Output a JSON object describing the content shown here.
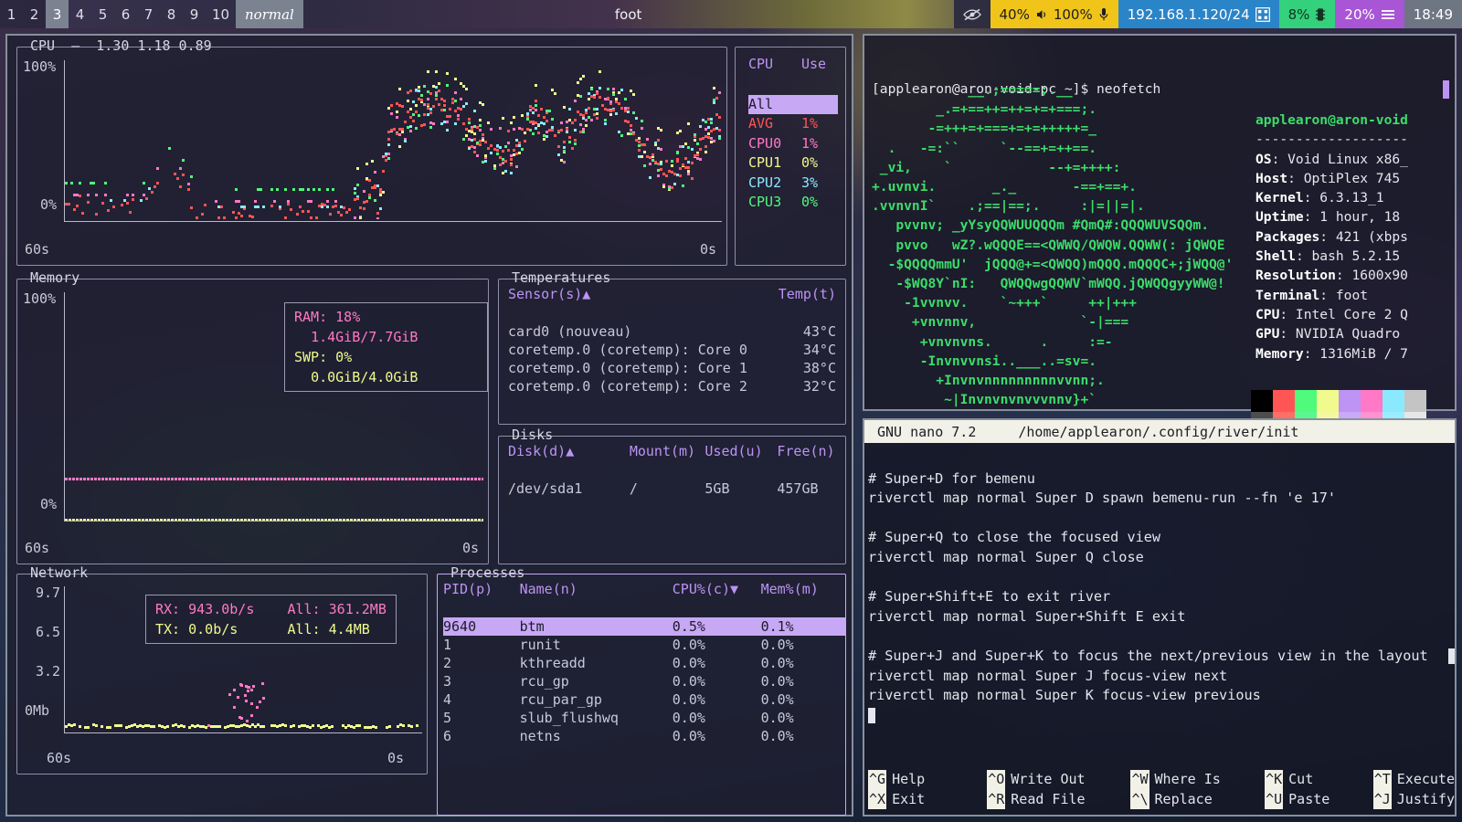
{
  "topbar": {
    "tags": [
      "1",
      "2",
      "3",
      "4",
      "5",
      "6",
      "7",
      "8",
      "9",
      "10"
    ],
    "active_tag": "3",
    "occupied_tags": [
      "1",
      "2",
      "3"
    ],
    "mode": "normal",
    "window_title": "foot",
    "modules": {
      "idle_icon": "eye-slash-icon",
      "volume_speaker": "40%",
      "volume_speaker_icon": "speaker-icon",
      "volume_mic": "100%",
      "volume_mic_icon": "microphone-icon",
      "network": "192.168.1.120/24",
      "network_icon": "network-qr-icon",
      "cpu": "8%",
      "cpu_icon": "chip-icon",
      "memory": "20%",
      "memory_icon": "memory-bars-icon",
      "clock": "18:49"
    },
    "colors": {
      "active_tag_bg": "#7b8391",
      "volume_bg": "#f0c419",
      "network_bg": "#2a84c8",
      "cpu_bg": "#34d17c",
      "memory_bg": "#a855d6",
      "clock_bg": "#6f7683"
    }
  },
  "btm": {
    "cpu_panel": {
      "title": "CPU",
      "load_avg": "1.30 1.18 0.89",
      "y_top": "100%",
      "y_bottom": "0%",
      "x_left": "60s",
      "x_right": "0s"
    },
    "cpu_table": {
      "headers": [
        "CPU",
        "Use"
      ],
      "rows": [
        {
          "name": "All",
          "use": "",
          "color": "#1c1c2b",
          "selected": true
        },
        {
          "name": "AVG",
          "use": "1%",
          "color": "#ff5555",
          "selected": false
        },
        {
          "name": "CPU0",
          "use": "1%",
          "color": "#ff79c6",
          "selected": false
        },
        {
          "name": "CPU1",
          "use": "0%",
          "color": "#f1fa8c",
          "selected": false
        },
        {
          "name": "CPU2",
          "use": "3%",
          "color": "#8be9fd",
          "selected": false
        },
        {
          "name": "CPU3",
          "use": "0%",
          "color": "#50fa7b",
          "selected": false
        }
      ]
    },
    "memory_panel": {
      "title": "Memory",
      "y_top": "100%",
      "y_bottom": "0%",
      "x_left": "60s",
      "x_right": "0s",
      "ram_label": "RAM:",
      "ram_pct": "18%",
      "ram_value": "1.4GiB/7.7GiB",
      "swp_label": "SWP:",
      "swp_pct": "0%",
      "swp_value": "0.0GiB/4.0GiB"
    },
    "temperatures": {
      "title": "Temperatures",
      "headers": [
        "Sensor(s)▲",
        "Temp(t)"
      ],
      "rows": [
        {
          "sensor": "card0 (nouveau)",
          "temp": "43°C"
        },
        {
          "sensor": "coretemp.0 (coretemp): Core 0",
          "temp": "34°C"
        },
        {
          "sensor": "coretemp.0 (coretemp): Core 1",
          "temp": "38°C"
        },
        {
          "sensor": "coretemp.0 (coretemp): Core 2",
          "temp": "32°C"
        }
      ]
    },
    "disks": {
      "title": "Disks",
      "headers": [
        "Disk(d)▲",
        "Mount(m)",
        "Used(u)",
        "Free(n)"
      ],
      "rows": [
        {
          "disk": "/dev/sda1",
          "mount": "/",
          "used": "5GB",
          "free": "457GB"
        }
      ]
    },
    "network_panel": {
      "title": "Network",
      "y_labels": [
        "9.7",
        "6.5",
        "3.2",
        "0Mb"
      ],
      "x_left": "60s",
      "x_right": "0s",
      "rx_label": "RX:",
      "rx_value": "943.0b/s",
      "rx_all_label": "All:",
      "rx_all_value": "361.2MB",
      "tx_label": "TX:",
      "tx_value": "0.0b/s",
      "tx_all_label": "All:",
      "tx_all_value": "4.4MB"
    },
    "processes": {
      "title": "Processes",
      "headers": [
        "PID(p)",
        "Name(n)",
        "CPU%(c)▼",
        "Mem%(m)"
      ],
      "rows": [
        {
          "pid": "9640",
          "name": "btm",
          "cpu": "0.5%",
          "mem": "0.1%",
          "selected": true
        },
        {
          "pid": "1",
          "name": "runit",
          "cpu": "0.0%",
          "mem": "0.0%",
          "selected": false
        },
        {
          "pid": "2",
          "name": "kthreadd",
          "cpu": "0.0%",
          "mem": "0.0%",
          "selected": false
        },
        {
          "pid": "3",
          "name": "rcu_gp",
          "cpu": "0.0%",
          "mem": "0.0%",
          "selected": false
        },
        {
          "pid": "4",
          "name": "rcu_par_gp",
          "cpu": "0.0%",
          "mem": "0.0%",
          "selected": false
        },
        {
          "pid": "5",
          "name": "slub_flushwq",
          "cpu": "0.0%",
          "mem": "0.0%",
          "selected": false
        },
        {
          "pid": "6",
          "name": "netns",
          "cpu": "0.0%",
          "mem": "0.0%",
          "selected": false
        }
      ]
    }
  },
  "chart_data": [
    {
      "type": "scatter",
      "title": "CPU",
      "xlabel": "",
      "ylabel": "",
      "ylim": [
        0,
        100
      ],
      "xlim": [
        60,
        0
      ],
      "ytick_labels": [
        "100%",
        "0%"
      ],
      "xtick_labels": [
        "60s",
        "0s"
      ],
      "legend": [
        "AVG",
        "CPU0",
        "CPU1",
        "CPU2",
        "CPU3"
      ],
      "series": [
        {
          "name": "AVG",
          "color": "#ff5555"
        },
        {
          "name": "CPU0",
          "color": "#ff79c6"
        },
        {
          "name": "CPU1",
          "color": "#f1fa8c"
        },
        {
          "name": "CPU2",
          "color": "#8be9fd"
        },
        {
          "name": "CPU3",
          "color": "#50fa7b"
        }
      ]
    },
    {
      "type": "line",
      "title": "Memory",
      "ylim": [
        0,
        100
      ],
      "xlim": [
        60,
        0
      ],
      "ytick_labels": [
        "100%",
        "0%"
      ],
      "xtick_labels": [
        "60s",
        "0s"
      ],
      "series": [
        {
          "name": "RAM",
          "color": "#ff79c6",
          "constant": 18
        },
        {
          "name": "SWP",
          "color": "#f1fa8c",
          "constant": 0
        }
      ]
    },
    {
      "type": "line",
      "title": "Network",
      "ylim": [
        0,
        9.7
      ],
      "xlim": [
        60,
        0
      ],
      "ytick_labels": [
        "9.7",
        "6.5",
        "3.2",
        "0Mb"
      ],
      "xtick_labels": [
        "60s",
        "0s"
      ],
      "series": [
        {
          "name": "RX",
          "color": "#ff79c6"
        },
        {
          "name": "TX",
          "color": "#f1fa8c"
        }
      ]
    }
  ],
  "terminal": {
    "prompt": "[applearon@aron-void-pc ~]$ neofetch",
    "ascii_art": "            __.;=====;.__\n        _.=+==++=++=+=+===;.\n       -=+++=+===+=+=+++++=_\n  .   -=:``     `--==+=++==.\n _vi,    `            --+=++++:\n+.uvnvi.       _._       -==+==+.\n.vvnvnI`    .;==|==;.     :|=||=|.\n   pvvnv; _yYsyQQWUUQQQm #QmQ#:QQQWUVSQQm.\n   pvvo   wZ?.wQQQE==<QWWQ/QWQW.QQWW(: jQWQE\n  -$QQQQmmU'  jQQQ@+=<QWQQ)mQQQ.mQQQC+;jWQQ@'\n   -$WQ8Y`nI:   QWQQwgQQWV`mWQQ.jQWQQgyyWW@!\n    -1vvnvv.    `~+++`     ++|+++\n     +vnvnnv,             `-|===\n      +vnvnvns.      .     :=-\n      -Invnvvnsi..___..=sv=.\n        +Invnvnnnnnnnnnvvnn;.\n         ~|Invnvnvnvvvnnv}+`",
    "info": [
      {
        "key": "",
        "value": "applearon@aron-void",
        "user": true
      },
      {
        "key": "",
        "value": "-------------------",
        "rule": true
      },
      {
        "key": "OS",
        "value": "Void Linux x86_"
      },
      {
        "key": "Host",
        "value": "OptiPlex 745"
      },
      {
        "key": "Kernel",
        "value": "6.3.13_1"
      },
      {
        "key": "Uptime",
        "value": "1 hour, 18"
      },
      {
        "key": "Packages",
        "value": "421 (xbps"
      },
      {
        "key": "Shell",
        "value": "bash 5.2.15"
      },
      {
        "key": "Resolution",
        "value": "1600x90"
      },
      {
        "key": "Terminal",
        "value": "foot"
      },
      {
        "key": "CPU",
        "value": "Intel Core 2 Q"
      },
      {
        "key": "GPU",
        "value": "NVIDIA Quadro"
      },
      {
        "key": "Memory",
        "value": "1316MiB / 7"
      }
    ],
    "palette_row1": [
      "#000000",
      "#ff5555",
      "#50fa7b",
      "#f1fa8c",
      "#bd93f4",
      "#ff79c6",
      "#8be9fd",
      "#c4c4c4"
    ],
    "palette_row2": [
      "#4d4d4d",
      "#ff6e67",
      "#5af78e",
      "#f4f99d",
      "#caa9fa",
      "#ff92d0",
      "#9aedfe",
      "#e6e6e6"
    ]
  },
  "nano": {
    "version": "GNU nano 7.2",
    "file": "/home/applearon/.config/river/init",
    "lines": [
      "",
      "# Super+D for bemenu",
      "riverctl map normal Super D spawn bemenu-run --fn 'e 17'",
      "",
      "# Super+Q to close the focused view",
      "riverctl map normal Super Q close",
      "",
      "# Super+Shift+E to exit river",
      "riverctl map normal Super+Shift E exit",
      "",
      "# Super+J and Super+K to focus the next/previous view in the layout",
      "riverctl map normal Super J focus-view next",
      "riverctl map normal Super K focus-view previous"
    ],
    "shortcuts": [
      [
        {
          "key": "^G",
          "label": "Help"
        },
        {
          "key": "^O",
          "label": "Write Out"
        },
        {
          "key": "^W",
          "label": "Where Is"
        },
        {
          "key": "^K",
          "label": "Cut"
        },
        {
          "key": "^T",
          "label": "Execute"
        }
      ],
      [
        {
          "key": "^X",
          "label": "Exit"
        },
        {
          "key": "^R",
          "label": "Read File"
        },
        {
          "key": "^\\",
          "label": "Replace"
        },
        {
          "key": "^U",
          "label": "Paste"
        },
        {
          "key": "^J",
          "label": "Justify"
        }
      ]
    ]
  }
}
